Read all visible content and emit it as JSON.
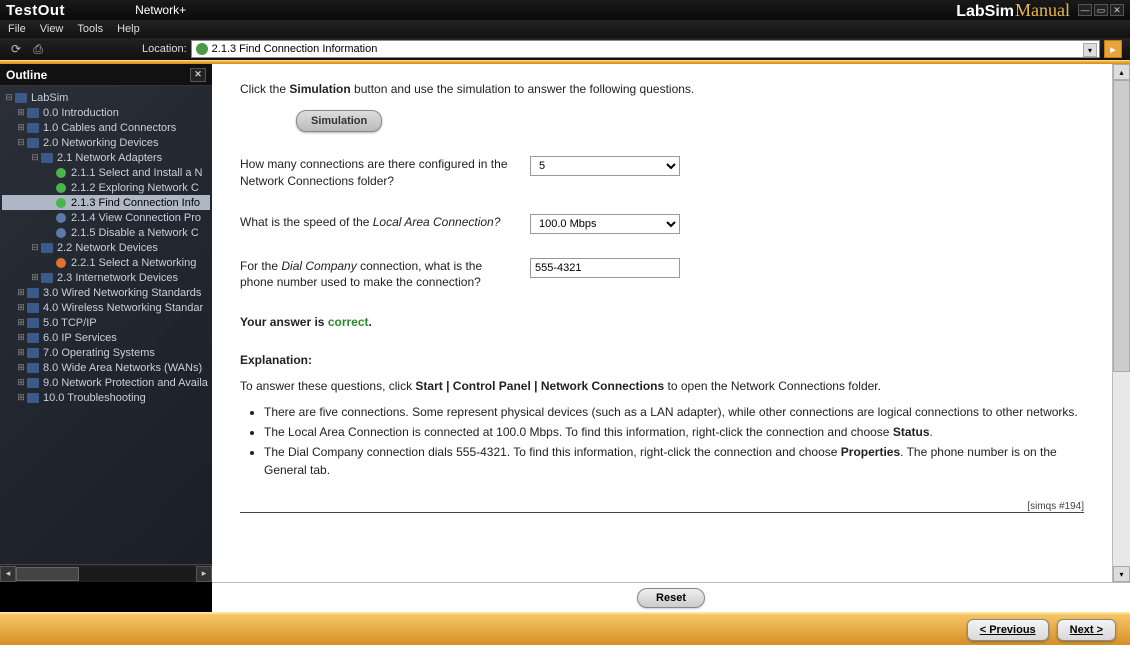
{
  "titlebar": {
    "brand": "TestOut",
    "course": "Network+",
    "logo_main": "LabSim",
    "logo_sub": "Manual"
  },
  "menubar": [
    "File",
    "View",
    "Tools",
    "Help"
  ],
  "toolbar": {
    "location_label": "Location:",
    "location_value": "2.1.3 Find Connection Information"
  },
  "sidebar": {
    "title": "Outline",
    "tree": [
      {
        "indent": 0,
        "exp": "⊟",
        "icon": "book",
        "label": "LabSim"
      },
      {
        "indent": 1,
        "exp": "⊞",
        "icon": "book",
        "label": "0.0 Introduction"
      },
      {
        "indent": 1,
        "exp": "⊞",
        "icon": "book",
        "label": "1.0 Cables and Connectors"
      },
      {
        "indent": 1,
        "exp": "⊟",
        "icon": "book",
        "label": "2.0 Networking Devices"
      },
      {
        "indent": 2,
        "exp": "⊟",
        "icon": "book",
        "label": "2.1 Network Adapters"
      },
      {
        "indent": 3,
        "exp": "",
        "icon": "topic-green",
        "label": "2.1.1 Select and Install a N"
      },
      {
        "indent": 3,
        "exp": "",
        "icon": "topic-green",
        "label": "2.1.2 Exploring Network C"
      },
      {
        "indent": 3,
        "exp": "",
        "icon": "topic-green",
        "label": "2.1.3 Find Connection Info",
        "selected": true
      },
      {
        "indent": 3,
        "exp": "",
        "icon": "topic-blue",
        "label": "2.1.4 View Connection Pro"
      },
      {
        "indent": 3,
        "exp": "",
        "icon": "topic-blue",
        "label": "2.1.5 Disable a Network C"
      },
      {
        "indent": 2,
        "exp": "⊟",
        "icon": "book",
        "label": "2.2 Network Devices"
      },
      {
        "indent": 3,
        "exp": "",
        "icon": "topic-orange",
        "label": "2.2.1 Select a Networking"
      },
      {
        "indent": 2,
        "exp": "⊞",
        "icon": "book",
        "label": "2.3 Internetwork Devices"
      },
      {
        "indent": 1,
        "exp": "⊞",
        "icon": "book",
        "label": "3.0 Wired Networking Standards"
      },
      {
        "indent": 1,
        "exp": "⊞",
        "icon": "book",
        "label": "4.0 Wireless Networking Standar"
      },
      {
        "indent": 1,
        "exp": "⊞",
        "icon": "book",
        "label": "5.0 TCP/IP"
      },
      {
        "indent": 1,
        "exp": "⊞",
        "icon": "book",
        "label": "6.0 IP Services"
      },
      {
        "indent": 1,
        "exp": "⊞",
        "icon": "book",
        "label": "7.0 Operating Systems"
      },
      {
        "indent": 1,
        "exp": "⊞",
        "icon": "book",
        "label": "8.0 Wide Area Networks (WANs)"
      },
      {
        "indent": 1,
        "exp": "⊞",
        "icon": "book",
        "label": "9.0 Network Protection and Availa"
      },
      {
        "indent": 1,
        "exp": "⊞",
        "icon": "book",
        "label": "10.0 Troubleshooting"
      }
    ]
  },
  "content": {
    "instruction_pre": "Click the ",
    "instruction_bold": "Simulation",
    "instruction_post": " button and use the simulation to answer the following questions.",
    "sim_button": "Simulation",
    "q1": {
      "text": "How many connections are there configured in the Network Connections folder?",
      "value": "5"
    },
    "q2": {
      "text_pre": "What is the speed of the ",
      "text_em": "Local Area Connection?",
      "value": "100.0 Mbps"
    },
    "q3": {
      "text_pre": "For the ",
      "text_em": "Dial Company",
      "text_post": " connection, what is the phone number used to make the connection?",
      "value": "555-4321"
    },
    "answer_pre": "Your answer is ",
    "answer_status": "correct",
    "answer_post": ".",
    "explanation_heading": "Explanation:",
    "explanation_intro_pre": "To answer these questions, click ",
    "explanation_intro_bold": "Start | Control Panel | Network Connections",
    "explanation_intro_post": " to open the Network Connections folder.",
    "bullets": [
      {
        "t": "There are five connections. Some represent physical devices (such as a LAN adapter), while other connections are logical connections to other networks."
      },
      {
        "pre": "The Local Area Connection is connected at 100.0 Mbps. To find this information, right-click the connection and choose ",
        "b": "Status",
        "post": "."
      },
      {
        "pre": "The Dial Company connection dials 555-4321. To find this information, right-click the connection and choose ",
        "b": "Properties",
        "post": ". The phone number is on the General tab."
      }
    ],
    "qid": "[simqs #194]"
  },
  "reset_label": "Reset",
  "footer": {
    "prev": "< Previous",
    "next": "Next >"
  }
}
